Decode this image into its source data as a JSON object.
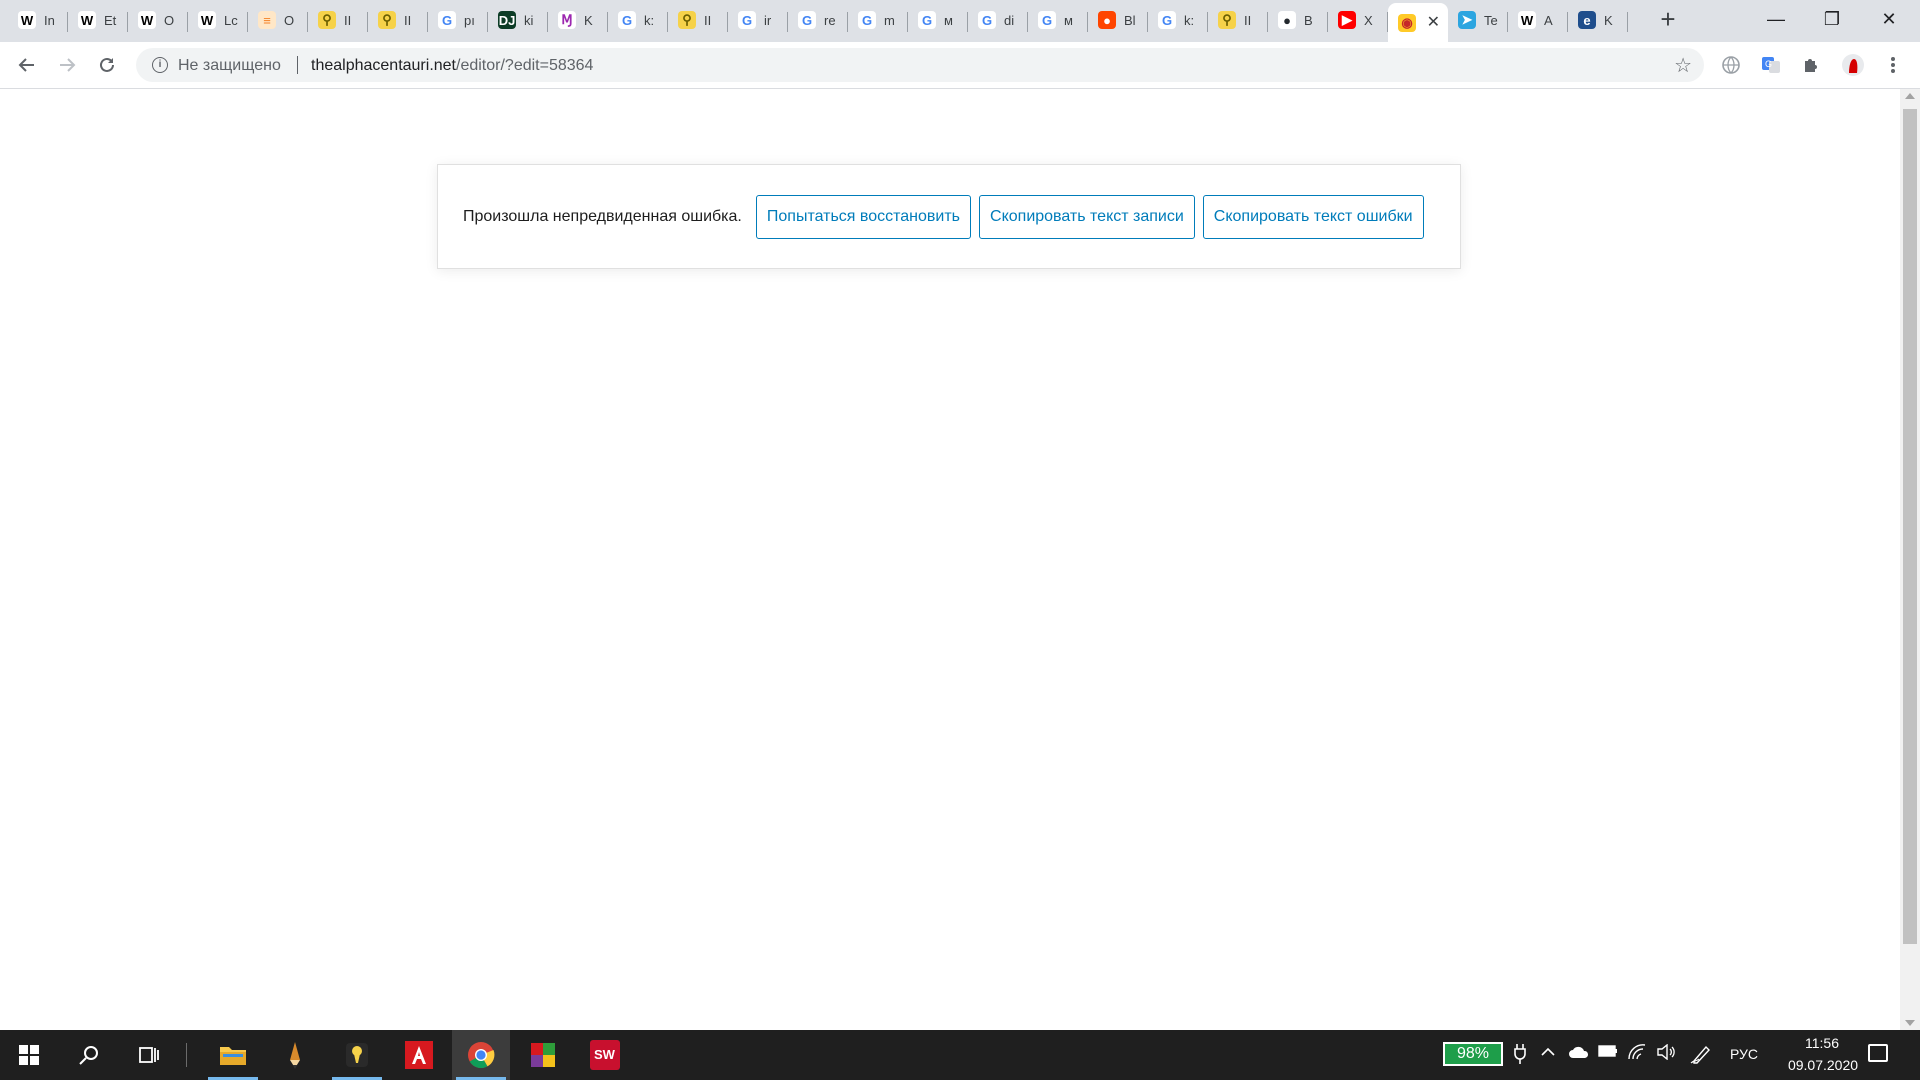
{
  "browser": {
    "tabs": [
      {
        "favicon": "wikipedia-icon",
        "glyph": "W",
        "label": "In",
        "color": "#000000",
        "bg": "#ffffff"
      },
      {
        "favicon": "wikipedia-icon",
        "glyph": "W",
        "label": "Et",
        "color": "#000000",
        "bg": "#ffffff"
      },
      {
        "favicon": "wikipedia-icon",
        "glyph": "W",
        "label": "O",
        "color": "#000000",
        "bg": "#ffffff"
      },
      {
        "favicon": "wikipedia-icon",
        "glyph": "W",
        "label": "Lc",
        "color": "#000000",
        "bg": "#ffffff"
      },
      {
        "favicon": "stackoverflow-icon",
        "glyph": "≡",
        "label": "O",
        "color": "#f48024",
        "bg": "#ffe7c7"
      },
      {
        "favicon": "keyhole-icon",
        "glyph": "⚲",
        "label": "II",
        "color": "#6b5e00",
        "bg": "#f6d24a"
      },
      {
        "favicon": "keyhole-icon",
        "glyph": "⚲",
        "label": "II",
        "color": "#6b5e00",
        "bg": "#f6d24a"
      },
      {
        "favicon": "google-icon",
        "glyph": "G",
        "label": "pı",
        "color": "#4285f4",
        "bg": "#ffffff"
      },
      {
        "favicon": "django-icon",
        "glyph": "DJ",
        "label": "ki",
        "color": "#ffffff",
        "bg": "#0c3c26"
      },
      {
        "favicon": "mu-icon",
        "glyph": "Ɱ",
        "label": "K",
        "color": "#9c27b0",
        "bg": "#ffffff"
      },
      {
        "favicon": "google-icon",
        "glyph": "G",
        "label": "k:",
        "color": "#4285f4",
        "bg": "#ffffff"
      },
      {
        "favicon": "keyhole-icon",
        "glyph": "⚲",
        "label": "II",
        "color": "#6b5e00",
        "bg": "#f6d24a"
      },
      {
        "favicon": "google-icon",
        "glyph": "G",
        "label": "ir",
        "color": "#4285f4",
        "bg": "#ffffff"
      },
      {
        "favicon": "google-icon",
        "glyph": "G",
        "label": "re",
        "color": "#4285f4",
        "bg": "#ffffff"
      },
      {
        "favicon": "google-icon",
        "glyph": "G",
        "label": "m",
        "color": "#4285f4",
        "bg": "#ffffff"
      },
      {
        "favicon": "google-icon",
        "glyph": "G",
        "label": "м",
        "color": "#4285f4",
        "bg": "#ffffff"
      },
      {
        "favicon": "google-icon",
        "glyph": "G",
        "label": "di",
        "color": "#4285f4",
        "bg": "#ffffff"
      },
      {
        "favicon": "google-icon",
        "glyph": "G",
        "label": "м",
        "color": "#4285f4",
        "bg": "#ffffff"
      },
      {
        "favicon": "reddit-icon",
        "glyph": "●",
        "label": "Bl",
        "color": "#ffffff",
        "bg": "#ff4500"
      },
      {
        "favicon": "google-icon",
        "glyph": "G",
        "label": "k:",
        "color": "#4285f4",
        "bg": "#ffffff"
      },
      {
        "favicon": "keyhole-icon",
        "glyph": "⚲",
        "label": "II",
        "color": "#6b5e00",
        "bg": "#f6d24a"
      },
      {
        "favicon": "github-icon",
        "glyph": "●",
        "label": "B",
        "color": "#24292e",
        "bg": "#ffffff"
      },
      {
        "favicon": "youtube-icon",
        "glyph": "▶",
        "label": "X",
        "color": "#ffffff",
        "bg": "#ff0000"
      },
      {
        "favicon": "site-icon",
        "glyph": "◉",
        "label": "",
        "color": "#c62828",
        "bg": "#ffca28",
        "active": true
      },
      {
        "favicon": "telegram-icon",
        "glyph": "➤",
        "label": "Te",
        "color": "#ffffff",
        "bg": "#2ca5e0"
      },
      {
        "favicon": "wikipedia-icon",
        "glyph": "W",
        "label": "A",
        "color": "#000000",
        "bg": "#ffffff"
      },
      {
        "favicon": "edge-icon",
        "glyph": "e",
        "label": "K",
        "color": "#ffffff",
        "bg": "#1f4e8c"
      }
    ],
    "security_label": "Не защищено",
    "url_host": "thealphacentauri.net",
    "url_path": "/editor/?edit=58364"
  },
  "notice": {
    "message": "Произошла непредвиденная ошибка.",
    "buttons": {
      "recover": "Попытаться восстановить",
      "copy_post": "Скопировать текст записи",
      "copy_error": "Скопировать текст ошибки"
    }
  },
  "taskbar": {
    "apps": [
      "file-explorer-icon",
      "pencil-app-icon",
      "keyhole-app-icon",
      "acrobat-icon",
      "chrome-icon",
      "winrar-icon",
      "solidworks-icon"
    ],
    "battery": "98%",
    "language": "РУС",
    "time": "11:56",
    "date": "09.07.2020"
  },
  "colors": {
    "wp_accent": "#007cba",
    "battery_green": "#1e9e4a"
  }
}
